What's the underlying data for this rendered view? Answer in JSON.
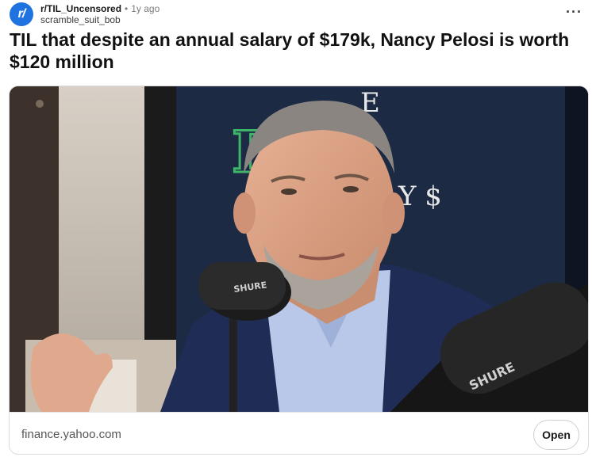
{
  "post": {
    "subreddit": "r/TIL_Uncensored",
    "separator": "•",
    "age": "1y ago",
    "author": "scramble_suit_bob",
    "title": "TIL that despite an annual salary of $179k, Nancy Pelosi is worth $120 million",
    "avatar_icon": "reddit-r-logo-icon",
    "avatar_text": "r/",
    "more_icon": "more-dots-icon",
    "more_label": "···"
  },
  "link": {
    "domain": "finance.yahoo.com",
    "open_label": "Open",
    "thumbnail": {
      "sign_lines": [
        "E",
        "EY",
        "Y $"
      ],
      "mic_brand": "SHURE"
    }
  },
  "colors": {
    "avatar_bg": "#1e73e0",
    "backdrop": "#1d2a44",
    "sign_green": "#3fb56a"
  }
}
